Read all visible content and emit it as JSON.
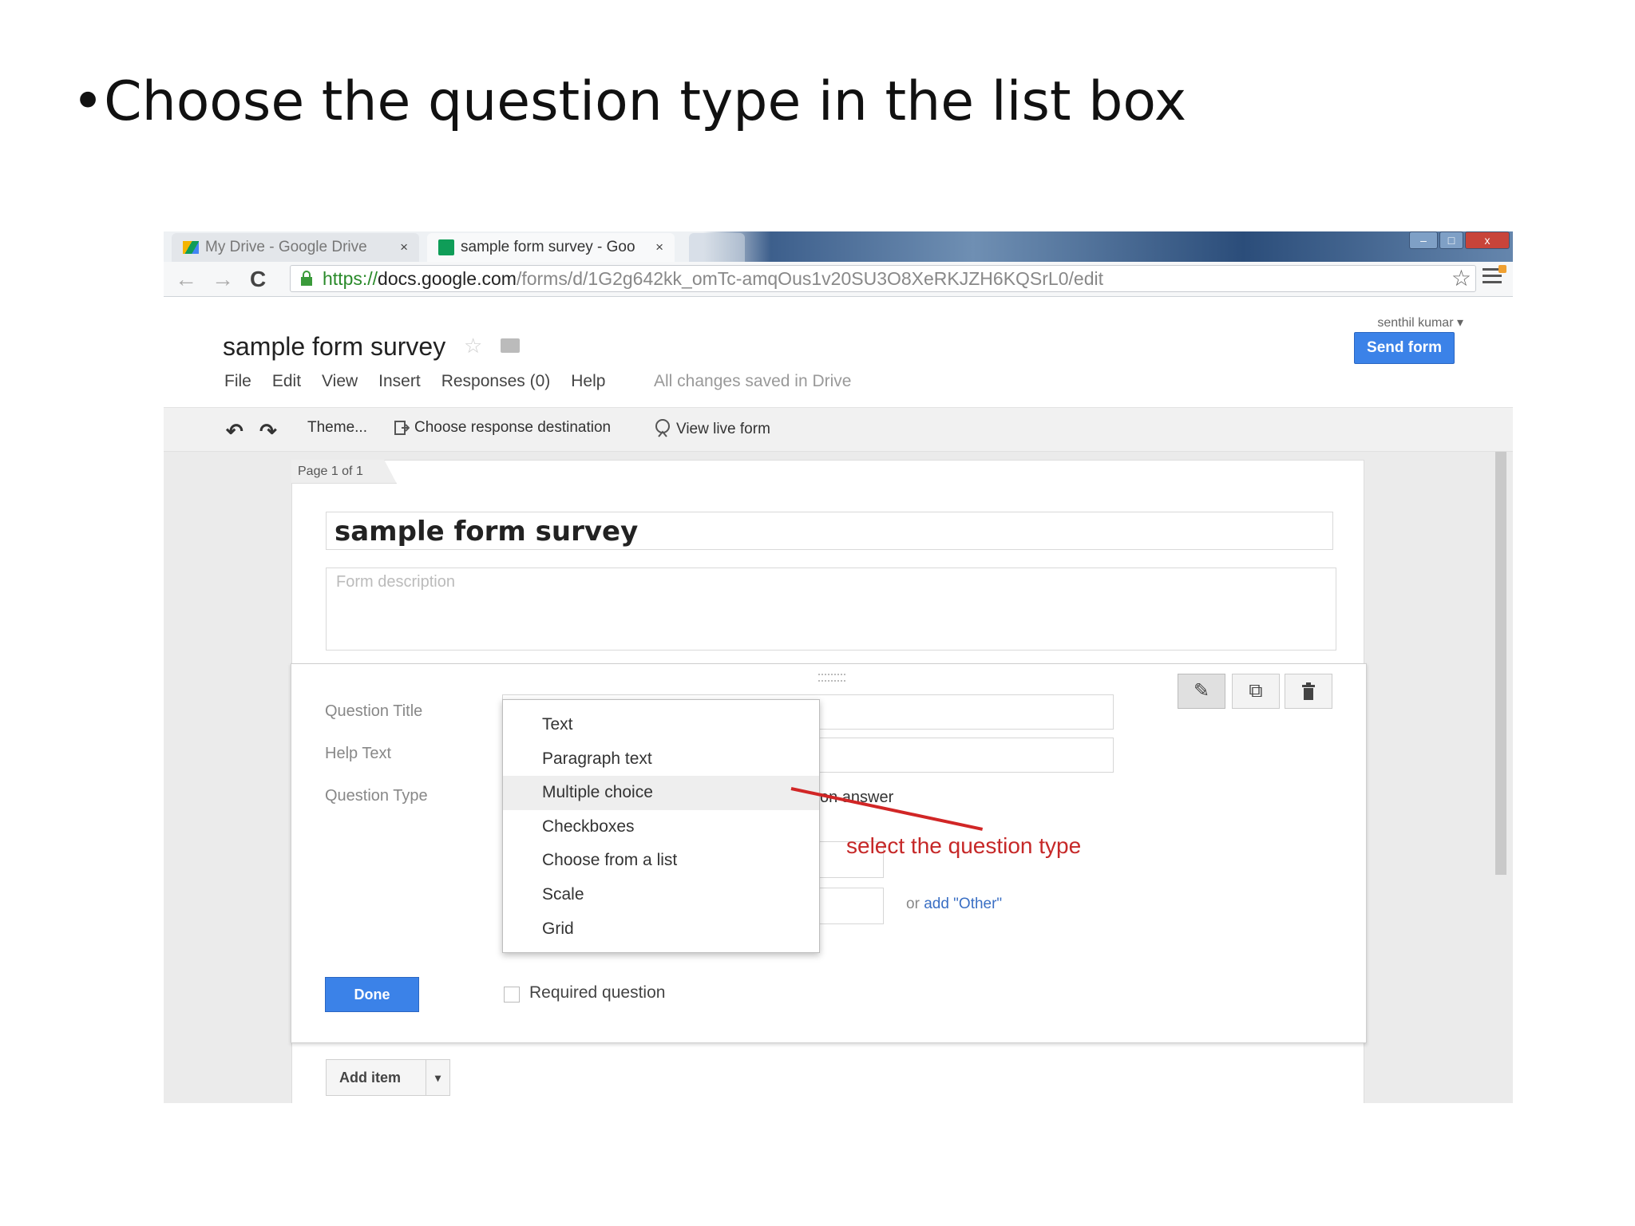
{
  "slide": {
    "bullet": "•Choose the question type in the list box"
  },
  "browser": {
    "tabs": [
      {
        "label": "My Drive - Google Drive",
        "close": "×"
      },
      {
        "label": "sample form survey - Goo",
        "close": "×"
      }
    ],
    "window_controls": {
      "minimize": "–",
      "maximize": "□",
      "close": "x"
    },
    "address": {
      "scheme": "https://",
      "domain": "docs.google.com",
      "path": "/forms/d/1G2g642kk_omTc-amqOus1v20SU3O8XeRKJZH6KQSrL0/edit"
    },
    "nav": {
      "back": "←",
      "forward": "→",
      "reload": "C"
    },
    "star": "☆"
  },
  "doc": {
    "title": "sample form survey",
    "title_star": "☆",
    "menu": [
      "File",
      "Edit",
      "View",
      "Insert",
      "Responses (0)",
      "Help"
    ],
    "saved_status": "All changes saved in Drive",
    "user": "senthil kumar ▾",
    "send_form": "Send form",
    "toolbar": {
      "undo": "↶",
      "redo": "↷",
      "theme": "Theme...",
      "destination": "Choose response destination",
      "live": "View live form"
    }
  },
  "form": {
    "page_label": "Page 1 of 1",
    "title": "sample form survey",
    "description_placeholder": "Form description",
    "question": {
      "title_label": "Question Title",
      "help_label": "Help Text",
      "type_label": "Question Type",
      "mc_answer_fragment": "on answer",
      "add_other": "or add \"Other\"",
      "add_other_link": "add \"Other\"",
      "done": "Done",
      "required": "Required question",
      "actions": {
        "edit": "✎",
        "duplicate": "⧉",
        "delete": "🗑"
      }
    },
    "question_types": [
      "Text",
      "Paragraph text",
      "Multiple choice",
      "Checkboxes",
      "Choose from a list",
      "Scale",
      "Grid"
    ],
    "highlighted_type": "Multiple choice",
    "add_item": "Add item",
    "add_item_caret": "▾"
  },
  "annotation": {
    "text": "select the question type",
    "color": "#c62828"
  }
}
